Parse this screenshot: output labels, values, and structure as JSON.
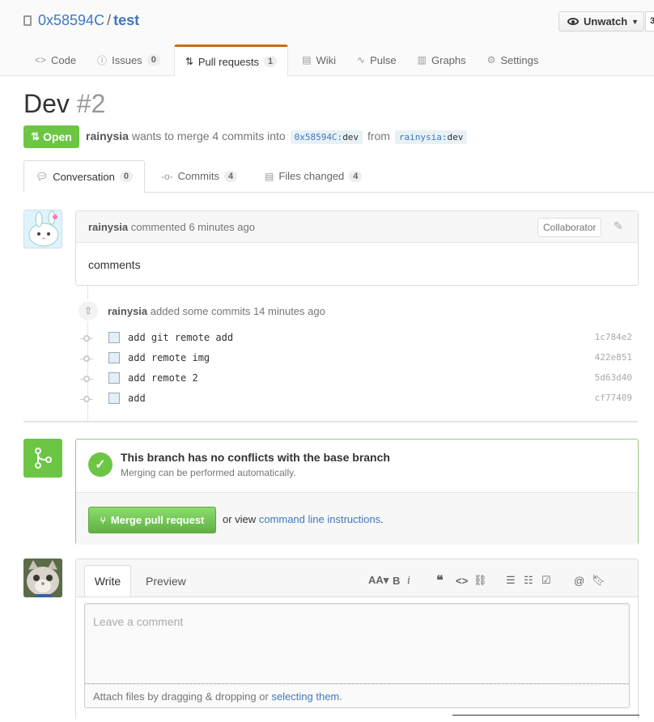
{
  "repo": {
    "owner": "0x58594C",
    "separator": "/",
    "name": "test"
  },
  "watch": {
    "label": "Unwatch",
    "count": "3"
  },
  "nav": [
    {
      "icon": "code-icon",
      "glyph": "<>",
      "label": "Code",
      "count": ""
    },
    {
      "icon": "issue-icon",
      "glyph": "ⓘ",
      "label": "Issues",
      "count": "0"
    },
    {
      "icon": "pull-request-icon",
      "glyph": "⇅",
      "label": "Pull requests",
      "count": "1"
    },
    {
      "icon": "book-icon",
      "glyph": "▤",
      "label": "Wiki",
      "count": ""
    },
    {
      "icon": "pulse-icon",
      "glyph": "∿",
      "label": "Pulse",
      "count": ""
    },
    {
      "icon": "graph-icon",
      "glyph": "▥",
      "label": "Graphs",
      "count": ""
    },
    {
      "icon": "gear-icon",
      "glyph": "⚙",
      "label": "Settings",
      "count": ""
    }
  ],
  "pr": {
    "title": "Dev",
    "number": "#2",
    "state": "Open",
    "author": "rainysia",
    "merge_text": "wants to merge 4 commits into",
    "base_owner": "0x58594C",
    "base_branch": "dev",
    "from_text": "from",
    "head_owner": "rainysia",
    "head_branch": "dev"
  },
  "tabs": {
    "conversation": {
      "label": "Conversation",
      "count": "0"
    },
    "commits": {
      "label": "Commits",
      "count": "4"
    },
    "files": {
      "label": "Files changed",
      "count": "4"
    }
  },
  "comment": {
    "author": "rainysia",
    "action": "commented 6 minutes ago",
    "badge": "Collaborator",
    "body": "comments"
  },
  "commits_event": {
    "author": "rainysia",
    "action": "added some commits 14 minutes ago",
    "items": [
      {
        "message": "add git remote add",
        "sha": "1c784e2"
      },
      {
        "message": "add remote img",
        "sha": "422e851"
      },
      {
        "message": "add remote 2",
        "sha": "5d63d40"
      },
      {
        "message": "add",
        "sha": "cf77409"
      }
    ]
  },
  "merge": {
    "title": "This branch has no conflicts with the base branch",
    "subtitle": "Merging can be performed automatically.",
    "button": "Merge pull request",
    "alt_prefix": "or view",
    "alt_link": "command line instructions",
    "alt_suffix": "."
  },
  "new_comment": {
    "write_tab": "Write",
    "preview_tab": "Preview",
    "placeholder": "Leave a comment",
    "attach_prefix": "Attach files by dragging & dropping or",
    "attach_link": "selecting them",
    "attach_suffix": "."
  },
  "colors": {
    "accent": "#4078c0",
    "open": "#6cc644",
    "tab_highlight": "#d26911"
  }
}
